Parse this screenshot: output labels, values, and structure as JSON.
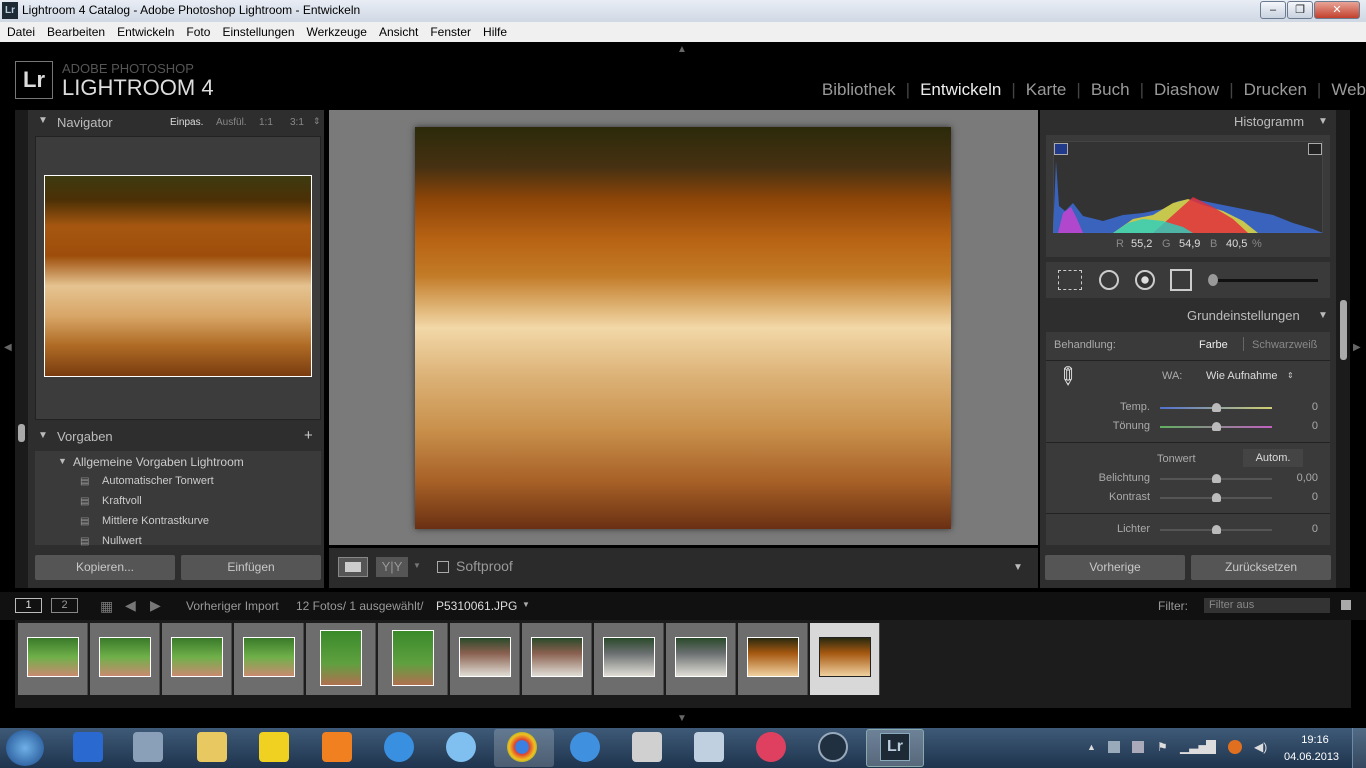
{
  "window": {
    "title": "Lightroom 4 Catalog - Adobe Photoshop Lightroom - Entwickeln",
    "app_icon": "Lr",
    "min": "–",
    "max": "❐",
    "close": "✕"
  },
  "menu": [
    "Datei",
    "Bearbeiten",
    "Entwickeln",
    "Foto",
    "Einstellungen",
    "Werkzeuge",
    "Ansicht",
    "Fenster",
    "Hilfe"
  ],
  "brand": {
    "logo": "Lr",
    "line1": "ADOBE PHOTOSHOP",
    "line2": "LIGHTROOM 4"
  },
  "modules": [
    "Bibliothek",
    "Entwickeln",
    "Karte",
    "Buch",
    "Diashow",
    "Drucken",
    "Web"
  ],
  "active_module": "Entwickeln",
  "left": {
    "navigator": {
      "title": "Navigator",
      "zoom": [
        "Einpas.",
        "Ausfül.",
        "1:1",
        "3:1"
      ]
    },
    "presets": {
      "title": "Vorgaben",
      "add": "+",
      "group": "Allgemeine Vorgaben Lightroom",
      "items": [
        "Automatischer Tonwert",
        "Kraftvoll",
        "Mittlere Kontrastkurve",
        "Nullwert"
      ]
    },
    "copy": "Kopieren...",
    "paste": "Einfügen"
  },
  "toolbar": {
    "softproof": "Softproof",
    "yy": "Y|Y"
  },
  "right": {
    "histogram": {
      "title": "Histogramm",
      "r_label": "R",
      "r": "55,2",
      "g_label": "G",
      "g": "54,9",
      "b_label": "B",
      "b": "40,5",
      "pct": "%"
    },
    "basic": {
      "title": "Grundeinstellungen",
      "treatment_label": "Behandlung:",
      "color": "Farbe",
      "bw": "Schwarzweiß",
      "wb_label": "WA:",
      "wb_value": "Wie Aufnahme",
      "temp_label": "Temp.",
      "temp": "0",
      "tint_label": "Tönung",
      "tint": "0",
      "tone_label": "Tonwert",
      "auto": "Autom.",
      "exposure_label": "Belichtung",
      "exposure": "0,00",
      "contrast_label": "Kontrast",
      "contrast": "0",
      "highlights_label": "Lichter",
      "highlights": "0"
    },
    "prev": "Vorherige",
    "reset": "Zurücksetzen"
  },
  "filmstrip": {
    "view1": "1",
    "view2": "2",
    "source": "Vorheriger Import",
    "count": "12 Fotos/ 1 ausgewählt/",
    "file": "P5310061.JPG",
    "filter_label": "Filter:",
    "filter_value": "Filter aus"
  },
  "taskbar": {
    "time": "19:16",
    "date": "04.06.2013",
    "lr": "Lr"
  }
}
